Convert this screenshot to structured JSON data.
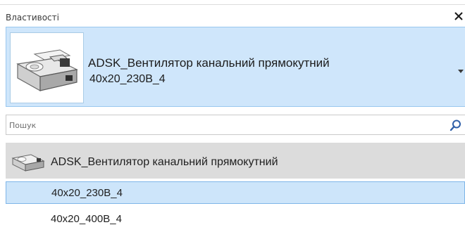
{
  "panel": {
    "title": "Властивості",
    "close_icon": "close-icon"
  },
  "type_selector": {
    "family": "ADSK_Вентилятор канальний прямокутний",
    "type": "40x20_230B_4",
    "dropdown_icon": "chevron-down-icon"
  },
  "search": {
    "placeholder": "Пошук",
    "value": "",
    "icon": "search-icon"
  },
  "list": {
    "group_label": "ADSK_Вентилятор канальний прямокутний",
    "items": [
      {
        "label": "40x20_230B_4",
        "selected": true
      },
      {
        "label": "40x20_400B_4",
        "selected": false
      }
    ]
  },
  "colors": {
    "selection_fill": "#cde5fa",
    "selection_border": "#7eb5e8",
    "header_fill": "#cfe6fb",
    "group_fill": "#dcdcdc",
    "accent": "#2f5fa8"
  }
}
